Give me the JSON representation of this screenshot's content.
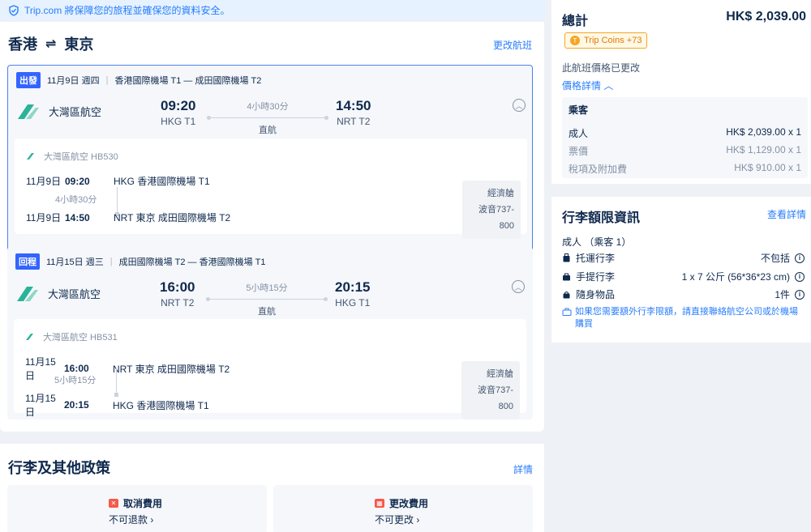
{
  "notice": {
    "text": "Trip.com 將保障您的旅程並確保您的資料安全。"
  },
  "route": {
    "from": "香港",
    "swap": "⇌",
    "to": "東京",
    "change_label": "更改航班"
  },
  "outbound": {
    "tag": "出發",
    "date": "11月9日 週四",
    "route_text": "香港國際機場 T1 — 成田國際機場 T2",
    "airline": "大灣區航空",
    "dep_time": "09:20",
    "dep_airport": "HKG T1",
    "duration": "4小時30分",
    "stop": "直航",
    "arr_time": "14:50",
    "arr_airport": "NRT T2",
    "detail": {
      "flight": "大灣區航空 HB530",
      "dep_date": "11月9日",
      "dep_time": "09:20",
      "dep_place": "HKG 香港國際機場 T1",
      "duration": "4小時30分",
      "arr_date": "11月9日",
      "arr_time": "14:50",
      "arr_place": "NRT 東京 成田國際機場 T2",
      "cabin": "經濟艙",
      "aircraft": "波音737-800"
    }
  },
  "inbound": {
    "tag": "回程",
    "date": "11月15日 週三",
    "route_text": "成田國際機場 T2 — 香港國際機場 T1",
    "airline": "大灣區航空",
    "dep_time": "16:00",
    "dep_airport": "NRT T2",
    "duration": "5小時15分",
    "stop": "直航",
    "arr_time": "20:15",
    "arr_airport": "HKG T1",
    "detail": {
      "flight": "大灣區航空 HB531",
      "dep_date": "11月15日",
      "dep_time": "16:00",
      "dep_place": "NRT 東京 成田國際機場 T2",
      "duration": "5小時15分",
      "arr_date": "11月15日",
      "arr_time": "20:15",
      "arr_place": "HKG 香港國際機場 T1",
      "cabin": "經濟艙",
      "aircraft": "波音737-800"
    }
  },
  "policy": {
    "title": "行李及其他政策",
    "details_label": "詳情",
    "cancel": {
      "label": "取消費用",
      "value": "不可退款 ›"
    },
    "change": {
      "label": "更改費用",
      "value": "不可更改 ›"
    }
  },
  "summary": {
    "total_label": "總計",
    "total_value": "HK$ 2,039.00",
    "coins": "Trip Coins +73",
    "price_changed": "此航班價格已更改",
    "price_details_label": "價格詳情 ︿",
    "passenger_header": "乘客",
    "rows": [
      {
        "label": "成人",
        "value": "HK$ 2,039.00 x 1"
      },
      {
        "label": "票價",
        "value": "HK$ 1,129.00 x 1"
      },
      {
        "label": "稅項及附加費",
        "value": "HK$ 910.00 x 1"
      }
    ]
  },
  "baggage": {
    "title": "行李額限資訊",
    "view_label": "查看詳情",
    "passenger": "成人 （乘客 1）",
    "items": [
      {
        "label": "托運行李",
        "value": "不包括"
      },
      {
        "label": "手提行李",
        "value": "1 x 7 公斤 (56*36*23 cm)"
      },
      {
        "label": "隨身物品",
        "value": "1件"
      }
    ],
    "note": "如果您需要額外行李限額，請直接聯絡航空公司或於機場購買"
  },
  "colors": {
    "accent": "#287dfa",
    "tag": "#3264ff",
    "text": "#0f294d",
    "coins": "#f5a623"
  }
}
